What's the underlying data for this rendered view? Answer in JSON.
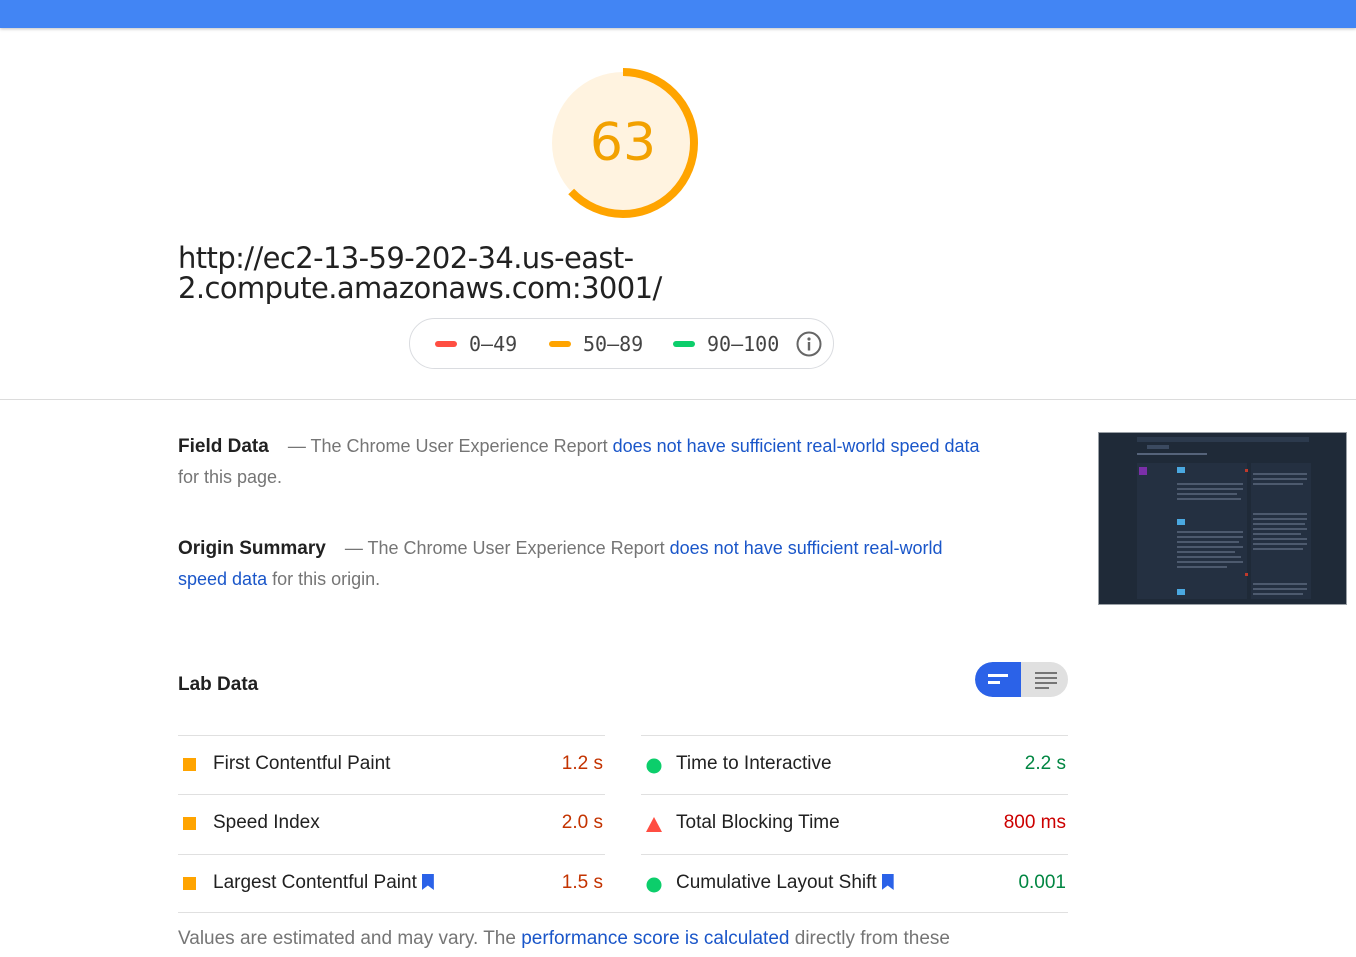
{
  "colors": {
    "topbar": "#4285f4",
    "average": "#ffa400",
    "fail": "#ff4e42",
    "pass": "#0cce6b",
    "link": "#1a56c9",
    "toggle_active": "#2b62e8"
  },
  "score": {
    "value": "63",
    "fraction": 0.63
  },
  "url": "http://ec2-13-59-202-34.us-east-2.compute.amazonaws.com:3001/",
  "legend": {
    "fail": "0–49",
    "average": "50–89",
    "pass": "90–100",
    "info_icon": "info-icon"
  },
  "field_data": {
    "heading": "Field Data",
    "prefix": " — The Chrome User Experience Report ",
    "link": "does not have sufficient real-world speed data",
    "suffix": " for this page."
  },
  "origin_summary": {
    "heading": "Origin Summary",
    "prefix": " — The Chrome User Experience Report ",
    "link": "does not have sufficient real-world speed data",
    "suffix": " for this origin."
  },
  "lab_data": {
    "heading": "Lab Data",
    "toggle_icons": [
      "list-view-icon",
      "expanded-view-icon"
    ],
    "metrics": [
      {
        "label": "First Contentful Paint",
        "value": "1.2 s",
        "status": "average",
        "bookmark": false
      },
      {
        "label": "Time to Interactive",
        "value": "2.2 s",
        "status": "pass",
        "bookmark": false
      },
      {
        "label": "Speed Index",
        "value": "2.0 s",
        "status": "average",
        "bookmark": false
      },
      {
        "label": "Total Blocking Time",
        "value": "800 ms",
        "status": "fail",
        "bookmark": false
      },
      {
        "label": "Largest Contentful Paint",
        "value": "1.5 s",
        "status": "average",
        "bookmark": true
      },
      {
        "label": "Cumulative Layout Shift",
        "value": "0.001",
        "status": "pass",
        "bookmark": true
      }
    ]
  },
  "footnote": {
    "prefix": "Values are estimated and may vary. The ",
    "link": "performance score is calculated",
    "suffix": " directly from these"
  }
}
